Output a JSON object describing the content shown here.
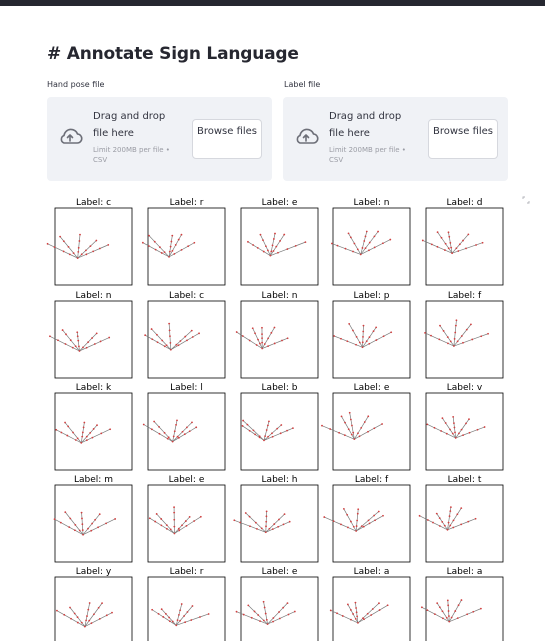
{
  "page": {
    "title": "# Annotate Sign Language"
  },
  "uploaders": [
    {
      "label": "Hand pose file",
      "drop_text": "Drag and drop file here",
      "limit_text": "Limit 200MB per file • CSV",
      "button_label": "Browse files"
    },
    {
      "label": "Label file",
      "drop_text": "Drag and drop file here",
      "limit_text": "Limit 200MB per file • CSV",
      "button_label": "Browse files"
    }
  ],
  "colors": {
    "topbar": "#262730",
    "dropzone_bg": "#f0f2f6",
    "pose_lines": "#7a7a7a",
    "pose_points": "#d04040"
  },
  "grid": {
    "labels": [
      [
        "Label: c",
        "Label: r",
        "Label: e",
        "Label: n",
        "Label: d"
      ],
      [
        "Label: n",
        "Label: c",
        "Label: n",
        "Label: p",
        "Label: f"
      ],
      [
        "Label: k",
        "Label: l",
        "Label: b",
        "Label: e",
        "Label: v"
      ],
      [
        "Label: m",
        "Label: e",
        "Label: h",
        "Label: f",
        "Label: t"
      ],
      [
        "Label: y",
        "Label: r",
        "Label: e",
        "Label: a",
        "Label: a"
      ]
    ]
  }
}
